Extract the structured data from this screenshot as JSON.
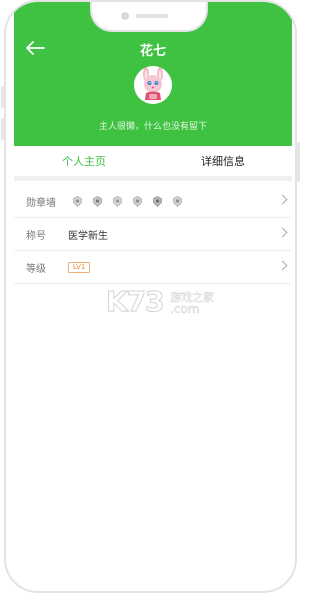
{
  "header": {
    "title": "花七",
    "motto": "主人很懒，什么也没有留下",
    "bg_color": "#3fc242"
  },
  "tabs": [
    {
      "label": "个人主页",
      "active": true
    },
    {
      "label": "详细信息",
      "active": false
    }
  ],
  "rows": {
    "badges": {
      "label": "勋章墙",
      "badge_count": 6
    },
    "title": {
      "label": "称号",
      "value": "医学新生"
    },
    "level": {
      "label": "等级",
      "value": "LV1"
    }
  },
  "watermark": {
    "brand": "K73",
    "site_cn": "游戏之家",
    "domain": ".com"
  },
  "icons": [
    "back-arrow-icon",
    "avatar-bunny",
    "badge-icon",
    "chevron-right-icon"
  ]
}
